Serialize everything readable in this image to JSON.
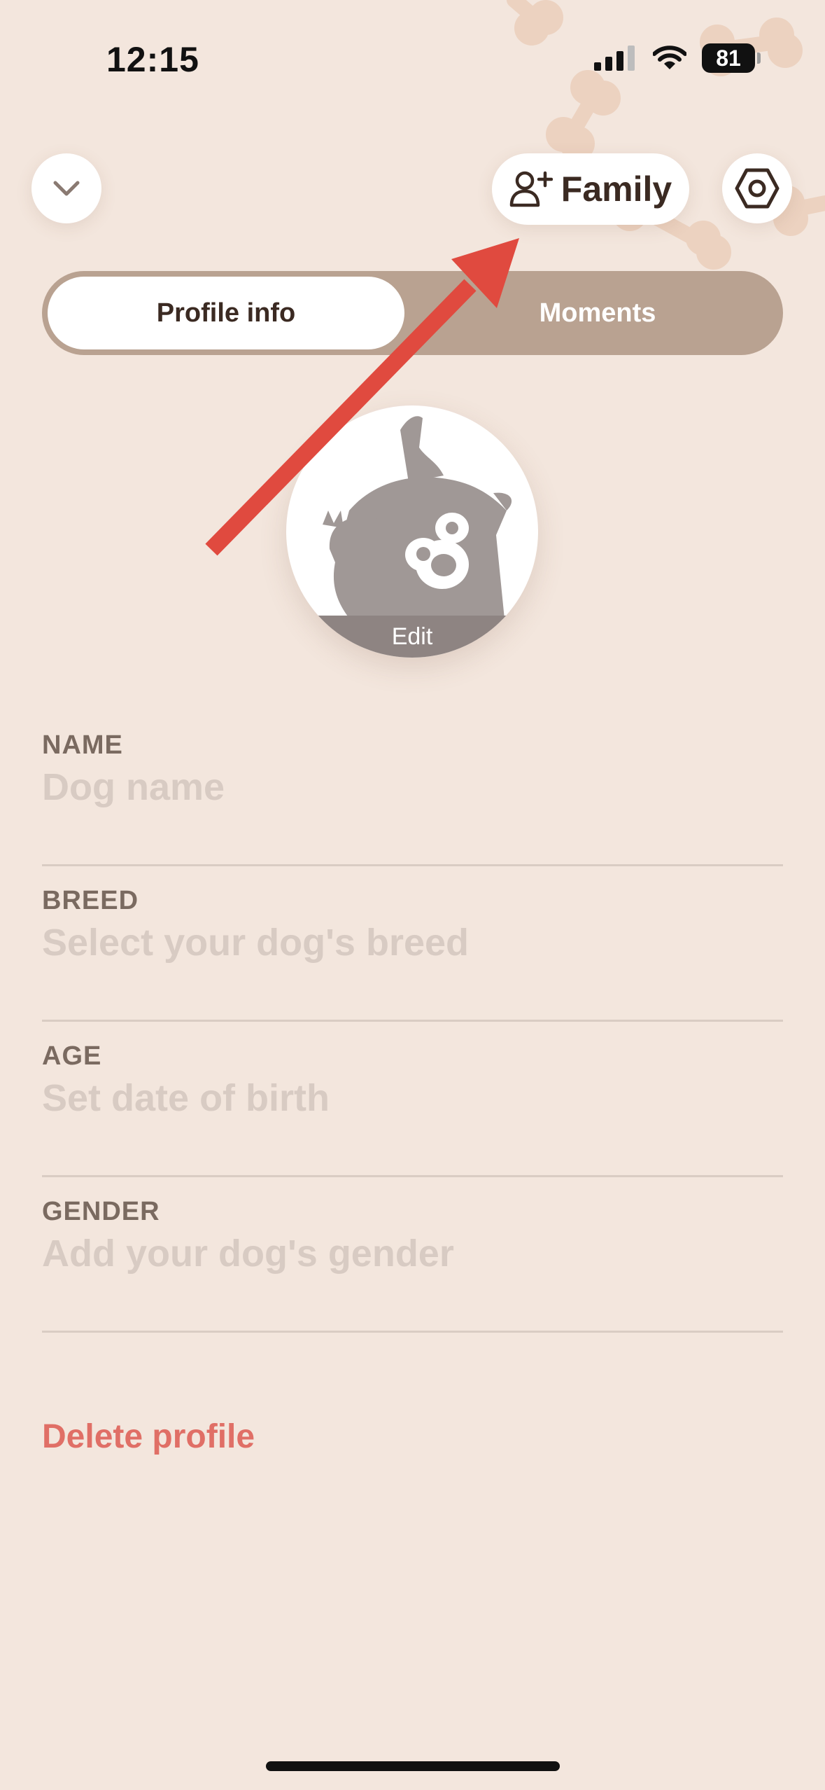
{
  "status_bar": {
    "time": "12:15",
    "battery": "81"
  },
  "header": {
    "family_label": "Family"
  },
  "tabs": {
    "active": "Profile info",
    "other": "Moments"
  },
  "avatar": {
    "edit_label": "Edit"
  },
  "fields": [
    {
      "label": "NAME",
      "placeholder": "Dog name"
    },
    {
      "label": "BREED",
      "placeholder": "Select your dog's breed"
    },
    {
      "label": "AGE",
      "placeholder": "Set date of birth"
    },
    {
      "label": "GENDER",
      "placeholder": "Add your dog's gender"
    }
  ],
  "delete_label": "Delete profile",
  "colors": {
    "background": "#f3e6dd",
    "segment": "#b9a291",
    "accent_red": "#e04a3f",
    "delete_text": "#e06f66",
    "avatar_gray": "#a09896"
  },
  "icons": {
    "collapse": "chevron-down-icon",
    "family": "add-user-icon",
    "settings": "hexagon-settings-icon"
  }
}
